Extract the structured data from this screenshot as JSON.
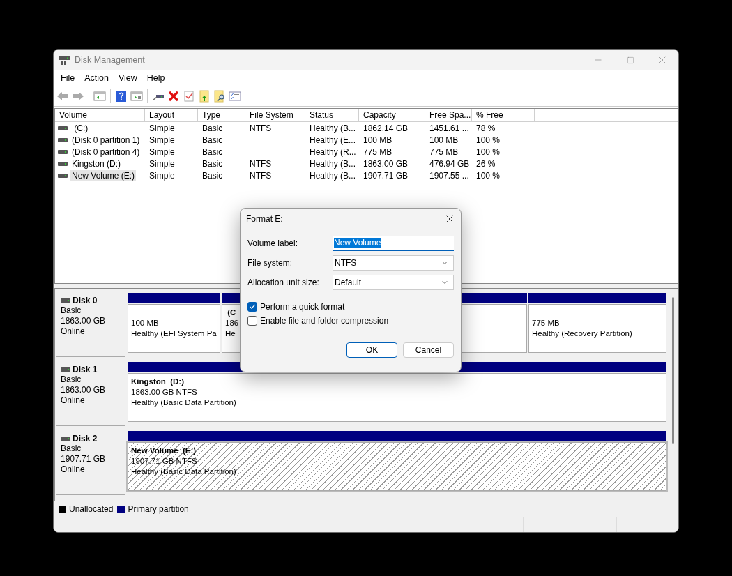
{
  "window": {
    "title": "Disk Management"
  },
  "menu": [
    "File",
    "Action",
    "View",
    "Help"
  ],
  "volumes": {
    "columns": [
      "Volume",
      "Layout",
      "Type",
      "File System",
      "Status",
      "Capacity",
      "Free Spa...",
      "% Free"
    ],
    "rows": [
      {
        "selected": false,
        "cells": [
          " (C:)",
          "Simple",
          "Basic",
          "NTFS",
          "Healthy (B...",
          "1862.14 GB",
          "1451.61 ...",
          "78 %"
        ]
      },
      {
        "selected": false,
        "cells": [
          "(Disk 0 partition 1)",
          "Simple",
          "Basic",
          "",
          "Healthy (E...",
          "100 MB",
          "100 MB",
          "100 %"
        ]
      },
      {
        "selected": false,
        "cells": [
          "(Disk 0 partition 4)",
          "Simple",
          "Basic",
          "",
          "Healthy (R...",
          "775 MB",
          "775 MB",
          "100 %"
        ]
      },
      {
        "selected": false,
        "cells": [
          "Kingston (D:)",
          "Simple",
          "Basic",
          "NTFS",
          "Healthy (B...",
          "1863.00 GB",
          "476.94 GB",
          "26 %"
        ]
      },
      {
        "selected": true,
        "cells": [
          "New Volume (E:)",
          "Simple",
          "Basic",
          "NTFS",
          "Healthy (B...",
          "1907.71 GB",
          "1907.55 ...",
          "100 %"
        ]
      }
    ]
  },
  "disks": [
    {
      "name": "Disk 0",
      "type": "Basic",
      "size": "1863.00 GB",
      "status": "Online",
      "partitions": [
        {
          "selected": false,
          "lines": [
            "100 MB",
            "Healthy (EFI System Pa"
          ]
        },
        {
          "selected": false,
          "title": " (C",
          "lines": [
            "186",
            "He"
          ]
        },
        {
          "selected": false,
          "lines": [
            "775 MB",
            "Healthy (Recovery Partition)"
          ]
        }
      ]
    },
    {
      "name": "Disk 1",
      "type": "Basic",
      "size": "1863.00 GB",
      "status": "Online",
      "partitions": [
        {
          "selected": false,
          "title": "Kingston  (D:)",
          "lines": [
            "1863.00 GB NTFS",
            "Healthy (Basic Data Partition)"
          ]
        }
      ]
    },
    {
      "name": "Disk 2",
      "type": "Basic",
      "size": "1907.71 GB",
      "status": "Online",
      "partitions": [
        {
          "selected": true,
          "title": "New Volume  (E:)",
          "lines": [
            "1907.71 GB NTFS",
            "Healthy (Basic Data Partition)"
          ]
        }
      ]
    }
  ],
  "legend": [
    {
      "label": "Unallocated",
      "color": "#000000"
    },
    {
      "label": "Primary partition",
      "color": "#000080"
    }
  ],
  "dialog": {
    "title": "Format E:",
    "fields": [
      {
        "kind": "text",
        "label": "Volume label:",
        "value": "New Volume",
        "text_selected": true
      },
      {
        "kind": "select",
        "label": "File system:",
        "value": "NTFS"
      },
      {
        "kind": "select",
        "label": "Allocation unit size:",
        "value": "Default"
      }
    ],
    "options": [
      {
        "label": "Perform a quick format",
        "checked": true
      },
      {
        "label": "Enable file and folder compression",
        "checked": false
      }
    ],
    "buttons": [
      {
        "label": "OK",
        "default": true
      },
      {
        "label": "Cancel",
        "default": false
      }
    ]
  }
}
